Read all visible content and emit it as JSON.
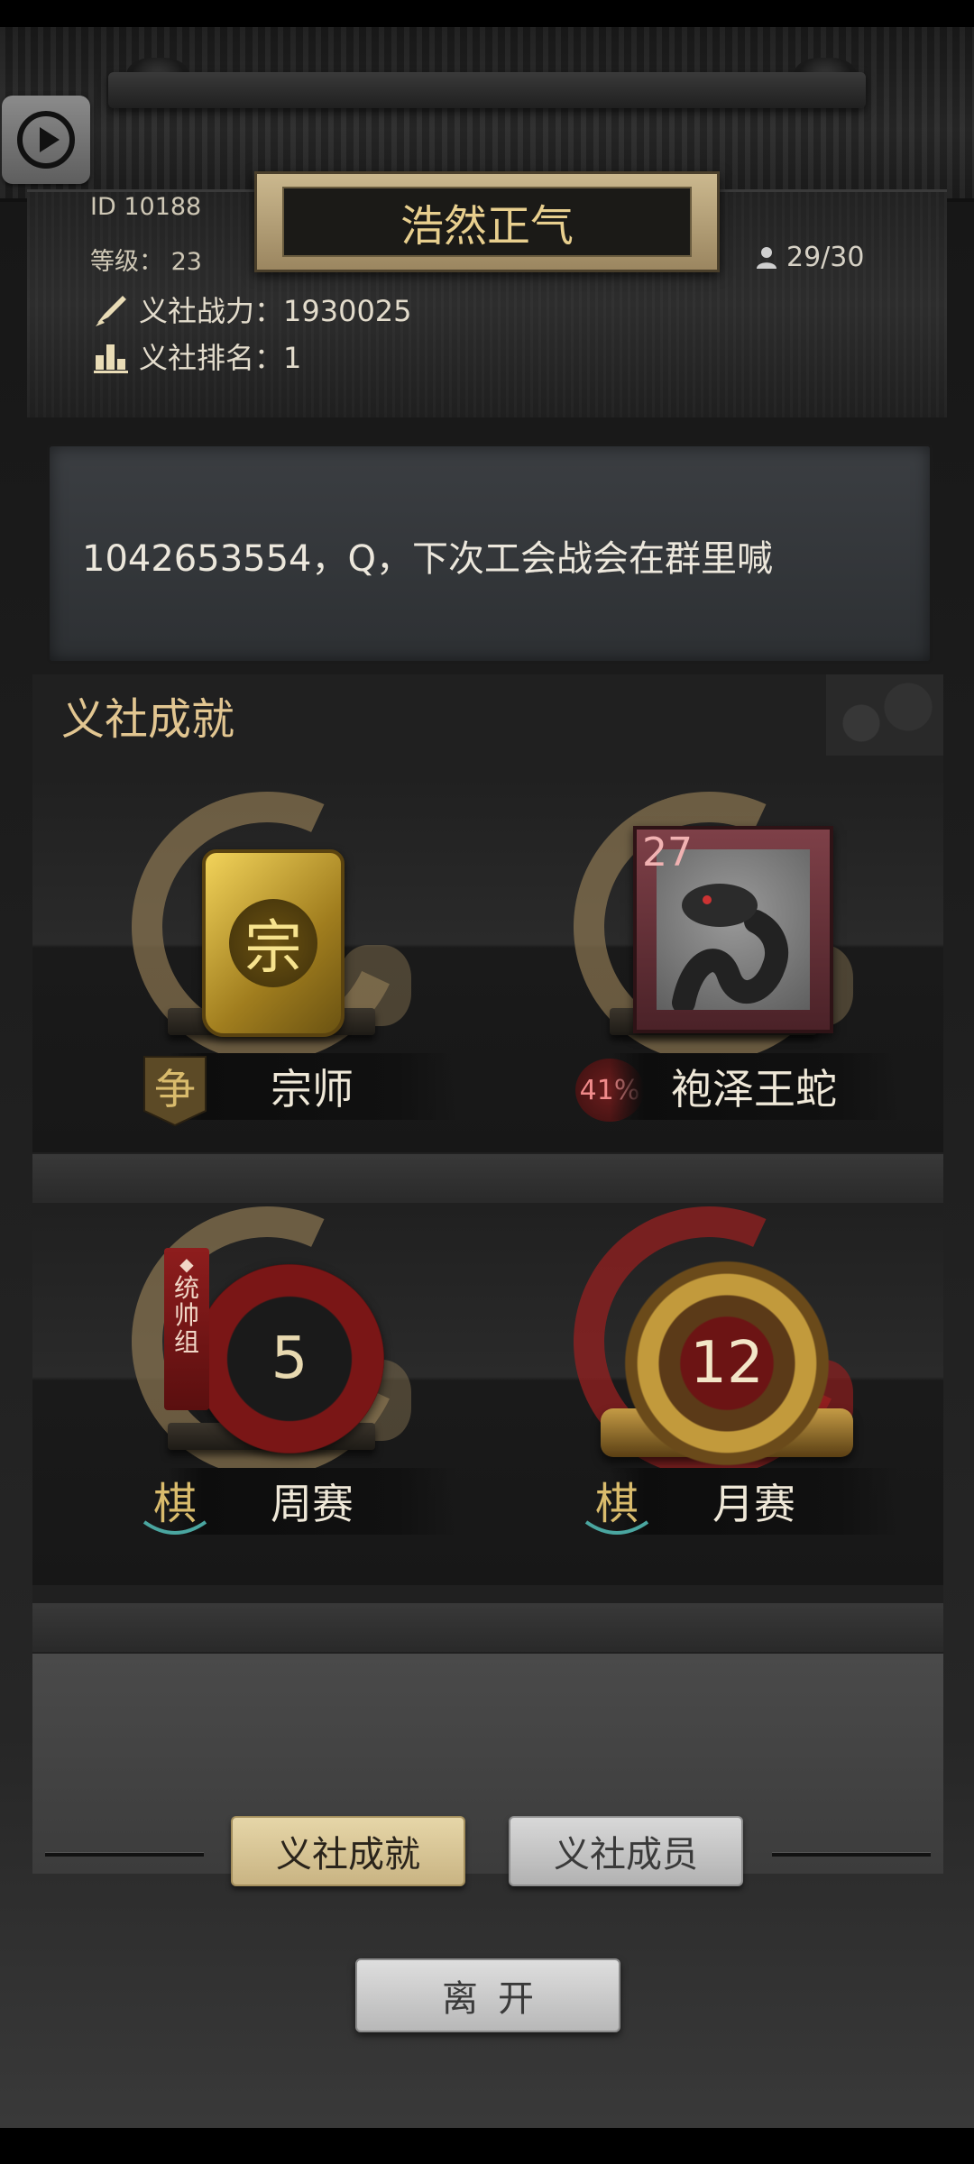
{
  "header": {
    "guild_name": "浩然正气",
    "id_text": "ID  10188",
    "level_text": "等级：  23",
    "members_text": "29/30",
    "power_text": "义社战力：1930025",
    "rank_text": "义社排名：1"
  },
  "notice": {
    "text": "1042653554，Q，下次工会战会在群里喊"
  },
  "achievements": {
    "title": "义社成就",
    "items": [
      {
        "name": "宗师",
        "emblem_char": "宗",
        "badge_char": "争"
      },
      {
        "name": "袍泽王蛇",
        "level": "27",
        "percent": "41%"
      },
      {
        "name": "周赛",
        "value": "5",
        "tag": [
          "统",
          "帅",
          "组"
        ],
        "badge_char": "棋"
      },
      {
        "name": "月赛",
        "value": "12",
        "badge_char": "棋"
      }
    ]
  },
  "tabs": {
    "achievements": "义社成就",
    "members": "义社成员"
  },
  "leave_label": "离开",
  "colors": {
    "gold_text": "#e8cf8e",
    "accent_red": "#b62a2a",
    "panel_bg": "#202020"
  }
}
